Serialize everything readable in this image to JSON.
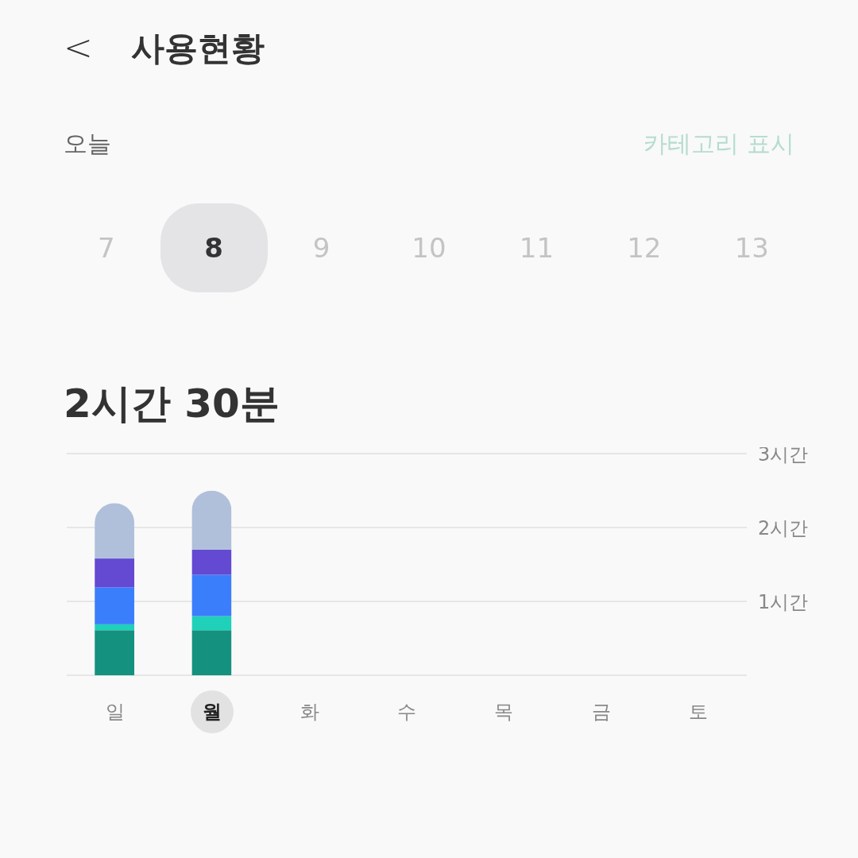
{
  "header": {
    "back": "<",
    "title": "사용현황"
  },
  "period": {
    "label": "오늘",
    "action": "카테고리 표시"
  },
  "dates": [
    {
      "label": "7",
      "selected": false
    },
    {
      "label": "8",
      "selected": true
    },
    {
      "label": "9",
      "selected": false
    },
    {
      "label": "10",
      "selected": false
    },
    {
      "label": "11",
      "selected": false
    },
    {
      "label": "12",
      "selected": false
    },
    {
      "label": "13",
      "selected": false
    }
  ],
  "total": "2시간 30분",
  "chart": {
    "chart_data": {
      "type": "bar",
      "stacked": true,
      "categories": [
        "일",
        "월",
        "화",
        "수",
        "목",
        "금",
        "토"
      ],
      "ylim": [
        0,
        3
      ],
      "yticks": [
        {
          "value": 1,
          "label": "1시간"
        },
        {
          "value": 2,
          "label": "2시간"
        },
        {
          "value": 3,
          "label": "3시간"
        }
      ],
      "series": [
        {
          "color": "#15917f",
          "values": [
            0.61,
            0.61,
            null,
            null,
            null,
            null,
            null
          ]
        },
        {
          "color": "#1fd1b8",
          "values": [
            0.08,
            0.19,
            null,
            null,
            null,
            null,
            null
          ]
        },
        {
          "color": "#3a7efb",
          "values": [
            0.5,
            0.56,
            null,
            null,
            null,
            null,
            null
          ]
        },
        {
          "color": "#6449d3",
          "values": [
            0.39,
            0.34,
            null,
            null,
            null,
            null,
            null
          ]
        },
        {
          "color": "#b0c0db",
          "values": [
            0.75,
            0.8,
            null,
            null,
            null,
            null,
            null
          ]
        }
      ]
    }
  },
  "days": [
    {
      "selected": false
    },
    {
      "selected": true
    },
    {
      "selected": false
    },
    {
      "selected": false
    },
    {
      "selected": false
    },
    {
      "selected": false
    },
    {
      "selected": false
    }
  ]
}
